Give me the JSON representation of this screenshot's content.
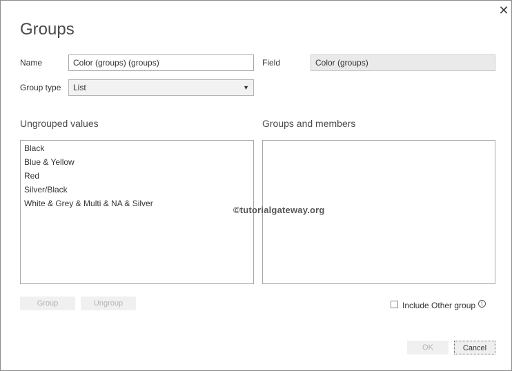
{
  "dialog": {
    "title": "Groups",
    "close_glyph": "✕"
  },
  "form": {
    "name_label": "Name",
    "name_value": "Color (groups) (groups)",
    "field_label": "Field",
    "field_value": "Color (groups)",
    "group_type_label": "Group type",
    "group_type_value": "List"
  },
  "ungrouped": {
    "label": "Ungrouped values",
    "items": [
      "Black",
      "Blue & Yellow",
      "Red",
      "Silver/Black",
      "White & Grey & Multi & NA & Silver"
    ]
  },
  "groups": {
    "label": "Groups and members",
    "items": []
  },
  "watermark": "©tutorialgateway.org",
  "buttons": {
    "group": "Group",
    "ungroup": "Ungroup",
    "ok": "OK",
    "cancel": "Cancel"
  },
  "include_other": {
    "label": "Include Other group",
    "checked": false,
    "info_glyph": "i"
  },
  "icons": {
    "close": "close-icon",
    "dropdown": "chevron-down-icon",
    "info": "info-icon"
  }
}
